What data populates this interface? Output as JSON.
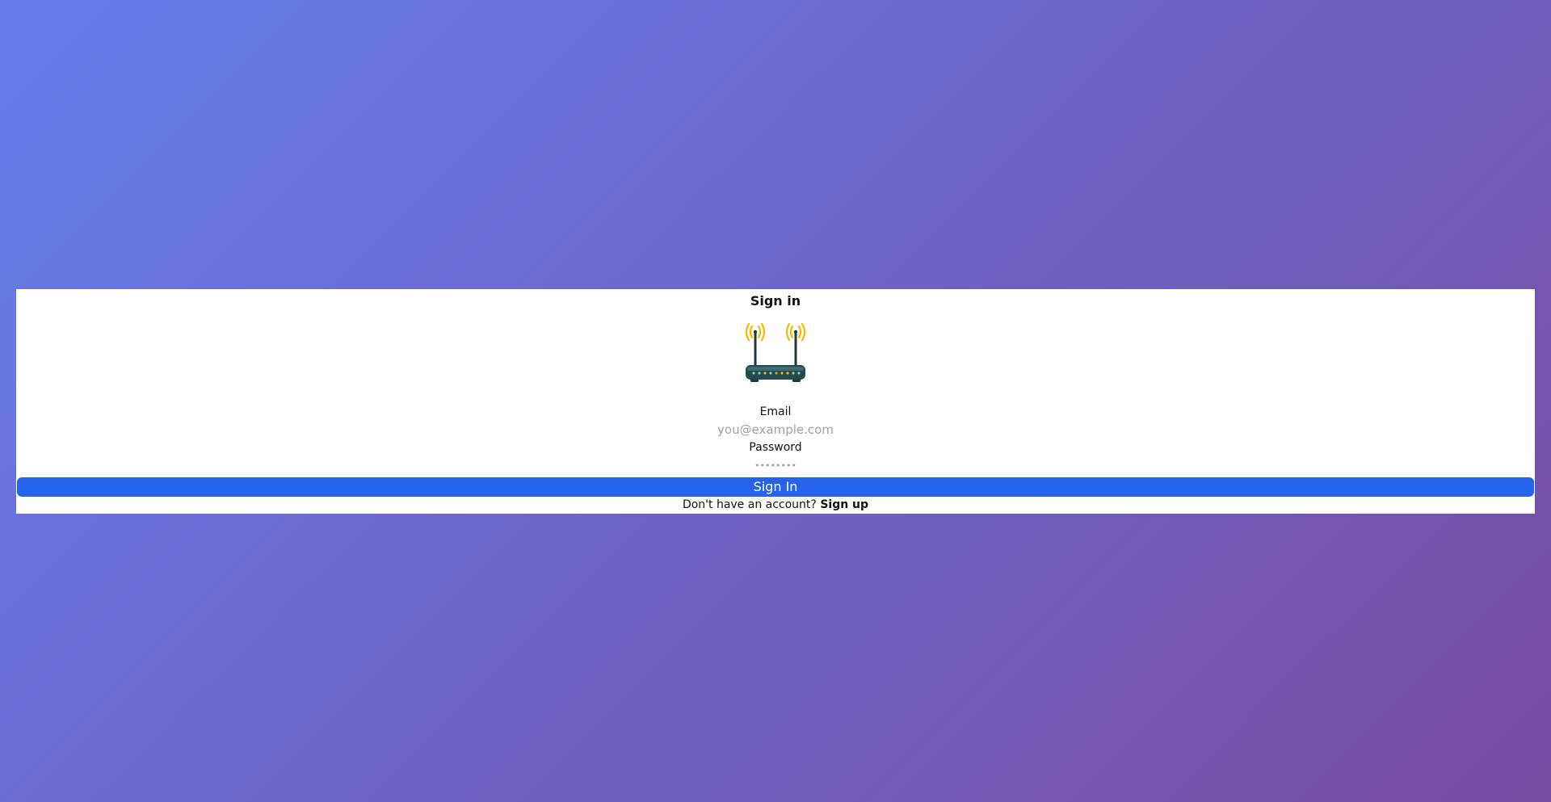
{
  "page": {
    "background_colors": [
      "#667eea",
      "#764ba2"
    ]
  },
  "card": {
    "title": "Sign in",
    "logo_icon": "wifi-router-icon"
  },
  "form": {
    "email_label": "Email",
    "email_placeholder": "you@example.com",
    "email_value": "",
    "password_label": "Password",
    "password_placeholder": "••••••••",
    "password_value": "",
    "submit_label": "Sign In",
    "submit_color": "#2563eb"
  },
  "footer": {
    "prompt_text": "Don't have an account?",
    "signup_link": "Sign up"
  }
}
